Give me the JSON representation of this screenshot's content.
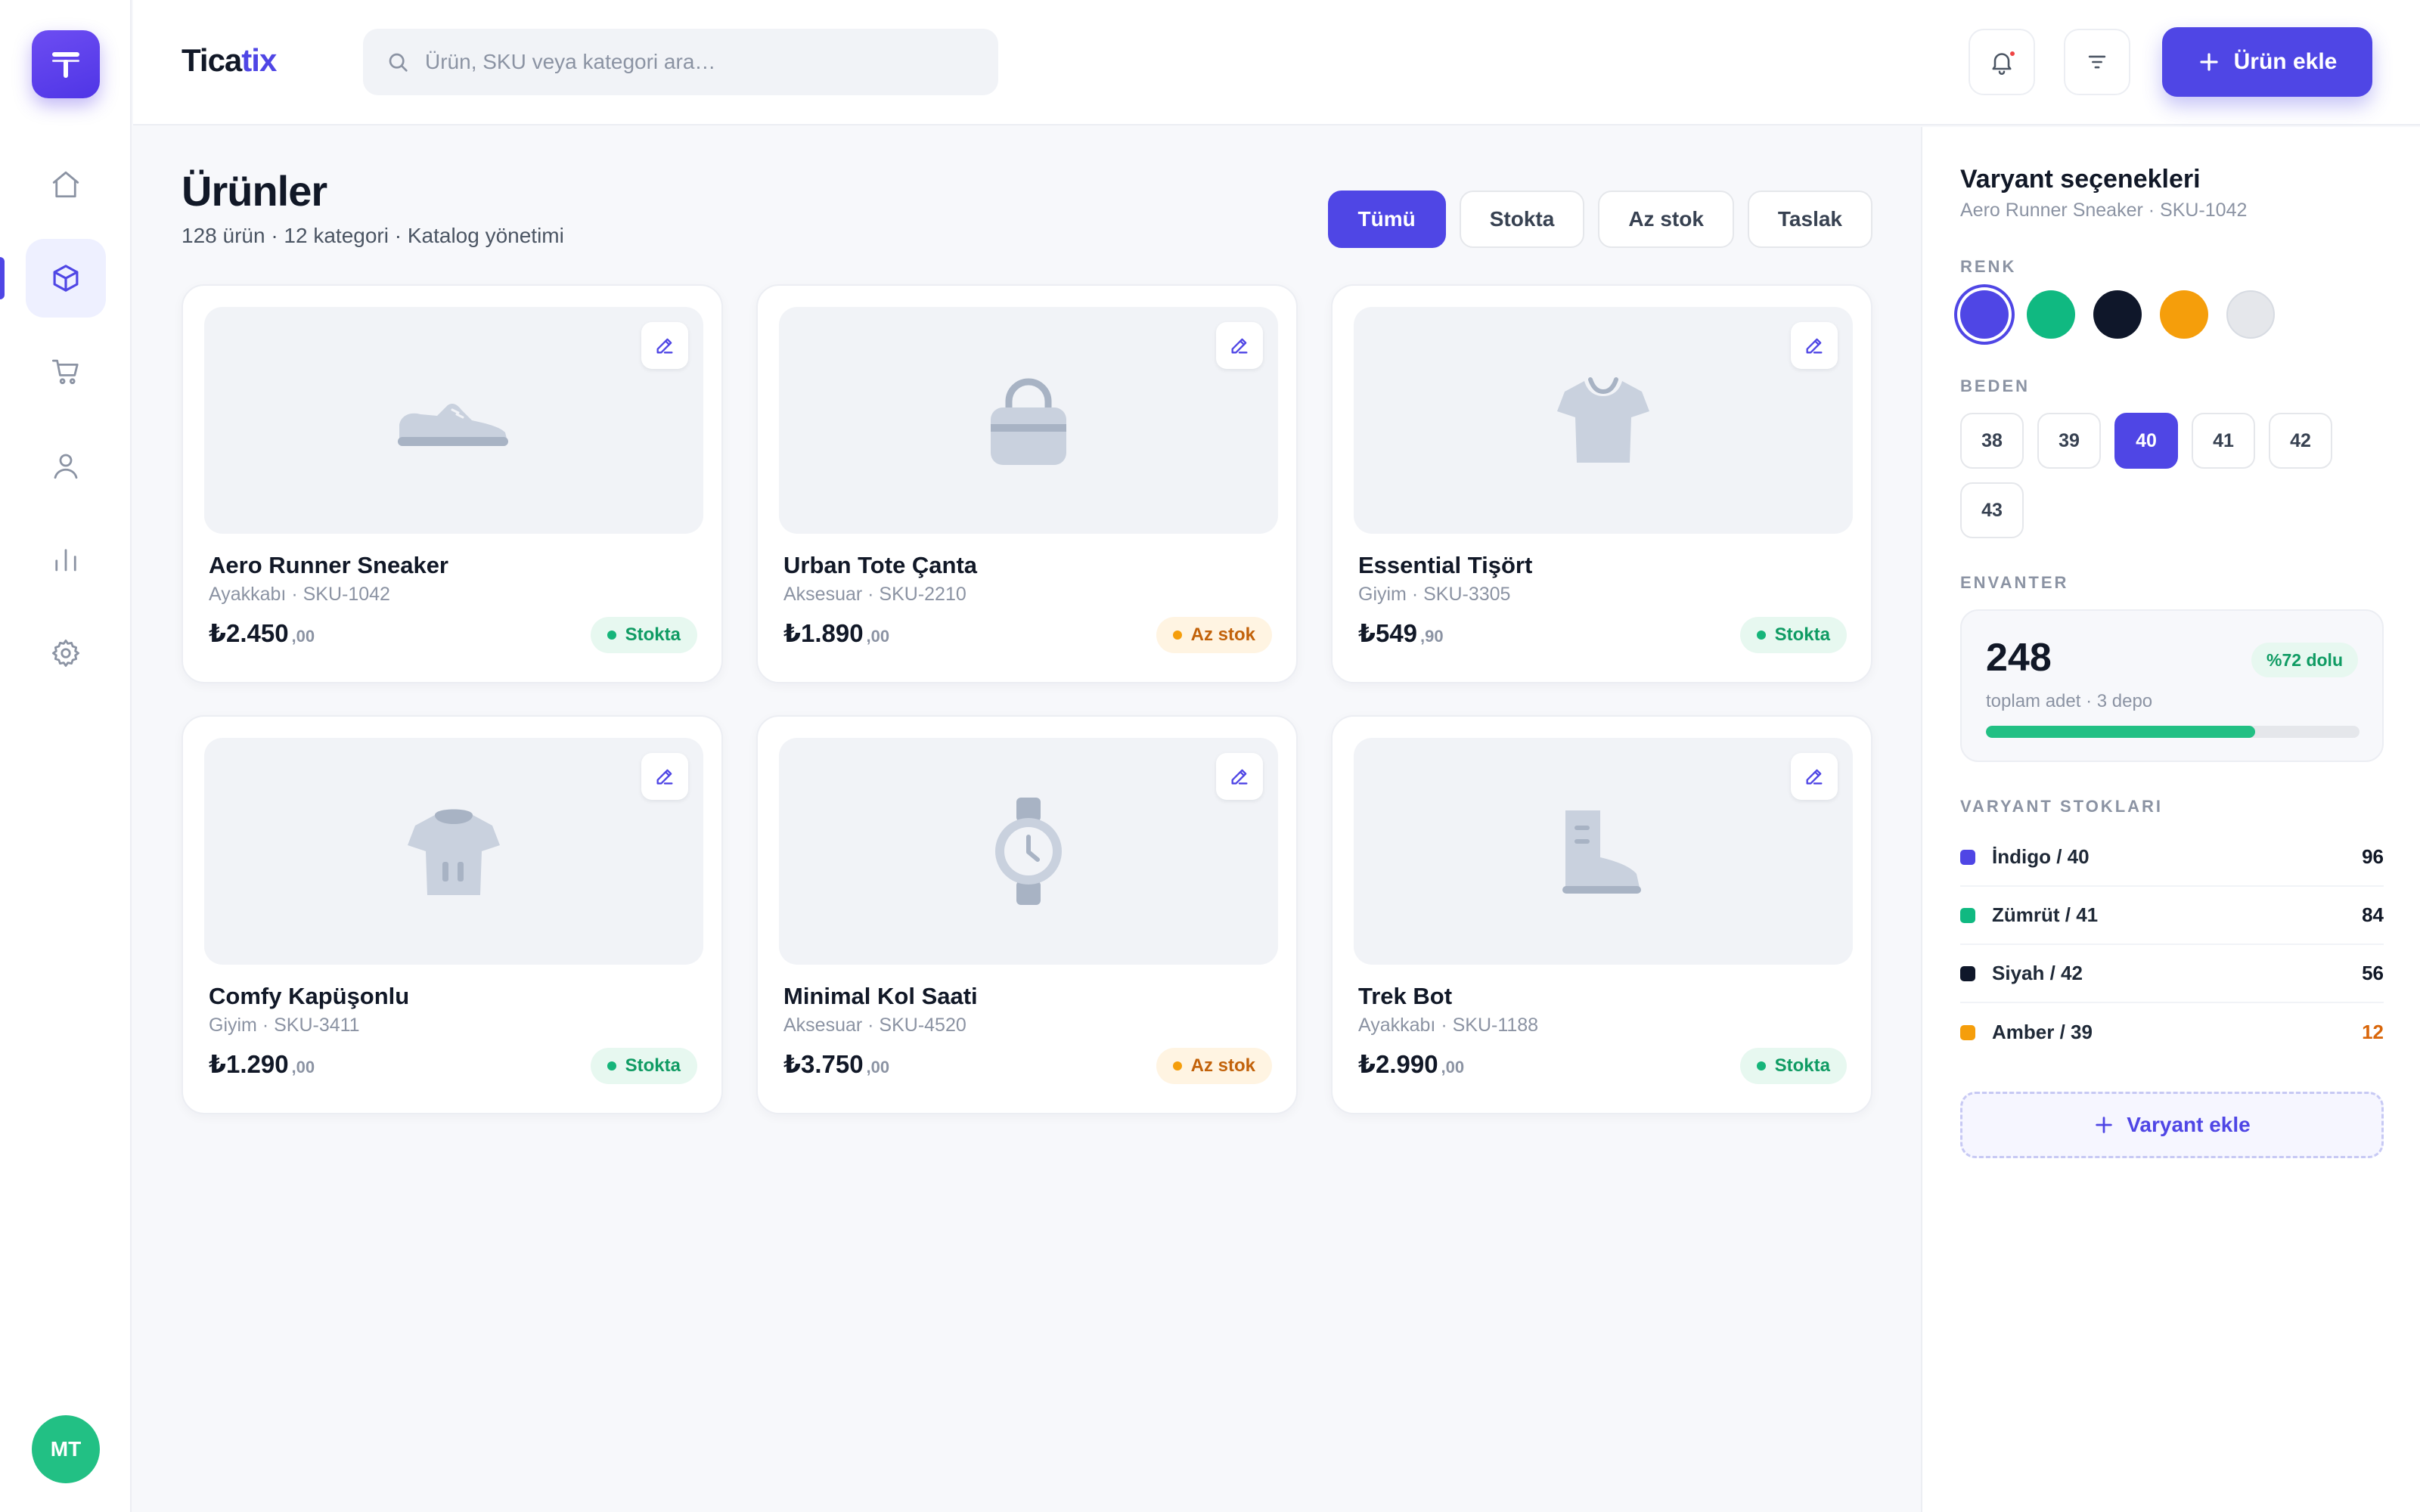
{
  "brand": {
    "name_main": "Tica",
    "name_accent": "tix",
    "logo_letter": "T"
  },
  "sidebar": {
    "items": [
      {
        "name": "home-icon"
      },
      {
        "name": "box-icon",
        "active": true
      },
      {
        "name": "cart-icon"
      },
      {
        "name": "user-icon"
      },
      {
        "name": "chart-icon"
      },
      {
        "name": "settings-icon"
      }
    ],
    "avatar_initials": "MT"
  },
  "search": {
    "placeholder": "Ürün, SKU veya kategori ara…",
    "value": ""
  },
  "header": {
    "add_button": "Ürün ekle"
  },
  "page": {
    "title": "Ürünler",
    "subtitle": "128 ürün · 12 kategori · Katalog yönetimi",
    "filters": [
      "Tümü",
      "Stokta",
      "Az stok",
      "Taslak"
    ],
    "active_filter": "Tümü"
  },
  "products": [
    {
      "name": "Aero Runner Sneaker",
      "meta": "Ayakkabı · SKU-1042",
      "price": "₺2.450",
      "cents": ",00",
      "status": "Stokta",
      "icon": "sneaker-icon"
    },
    {
      "name": "Urban Tote Çanta",
      "meta": "Aksesuar · SKU-2210",
      "price": "₺1.890",
      "cents": ",00",
      "status": "Az stok",
      "icon": "bag-icon"
    },
    {
      "name": "Essential Tişört",
      "meta": "Giyim · SKU-3305",
      "price": "₺549",
      "cents": ",90",
      "status": "Stokta",
      "icon": "tshirt-icon"
    },
    {
      "name": "Comfy Kapüşonlu",
      "meta": "Giyim · SKU-3411",
      "price": "₺1.290",
      "cents": ",00",
      "status": "Stokta",
      "icon": "hoodie-icon"
    },
    {
      "name": "Minimal Kol Saati",
      "meta": "Aksesuar · SKU-4520",
      "price": "₺3.750",
      "cents": ",00",
      "status": "Az stok",
      "icon": "watch-icon"
    },
    {
      "name": "Trek Bot",
      "meta": "Ayakkabı · SKU-1188",
      "price": "₺2.990",
      "cents": ",00",
      "status": "Stokta",
      "icon": "boot-icon"
    }
  ],
  "variants": {
    "title": "Varyant seçenekleri",
    "subtitle": "Aero Runner Sneaker · SKU-1042",
    "color_label": "RENK",
    "colors": [
      "#4f46e5",
      "#10b981",
      "#0f172a",
      "#f59e0b",
      "#e5e7eb"
    ],
    "selected_color": "#4f46e5",
    "size_label": "BEDEN",
    "sizes": [
      "38",
      "39",
      "40",
      "41",
      "42",
      "43"
    ],
    "selected_size": "40",
    "inventory_label": "ENVANTER",
    "inventory_total": "248",
    "inventory_fill_label": "%72 dolu",
    "inventory_fill": 0.72,
    "inventory_sub": "toplam adet · 3 depo",
    "stock_label": "VARYANT STOKLARI",
    "stock_rows": [
      {
        "name": "İndigo / 40",
        "value": "96",
        "color": "#4f46e5",
        "warn": false
      },
      {
        "name": "Zümrüt / 41",
        "value": "84",
        "color": "#10b981",
        "warn": false
      },
      {
        "name": "Siyah / 42",
        "value": "56",
        "color": "#0f172a",
        "warn": false
      },
      {
        "name": "Amber / 39",
        "value": "12",
        "color": "#f59e0b",
        "warn": true
      }
    ],
    "add_button": "Varyant ekle"
  }
}
